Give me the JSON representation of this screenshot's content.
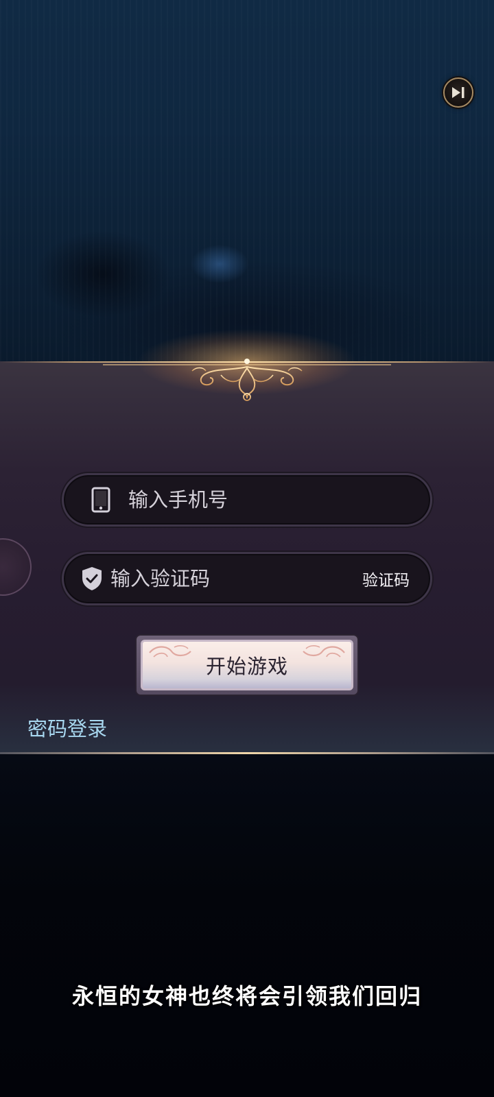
{
  "login": {
    "phone_placeholder": "输入手机号",
    "code_placeholder": "输入验证码",
    "get_code_label": "验证码",
    "start_button_label": "开始游戏",
    "password_login_label": "密码登录"
  },
  "story": {
    "subtitle": "永恒的女神也终将会引领我们回归"
  },
  "icons": {
    "skip": "skip-forward-icon",
    "phone": "phone-icon",
    "shield": "shield-check-icon"
  },
  "colors": {
    "panel": "#2a2032",
    "input_bg": "#19141d",
    "link": "#a8d8f0",
    "gold_accent": "#f0c27a"
  }
}
